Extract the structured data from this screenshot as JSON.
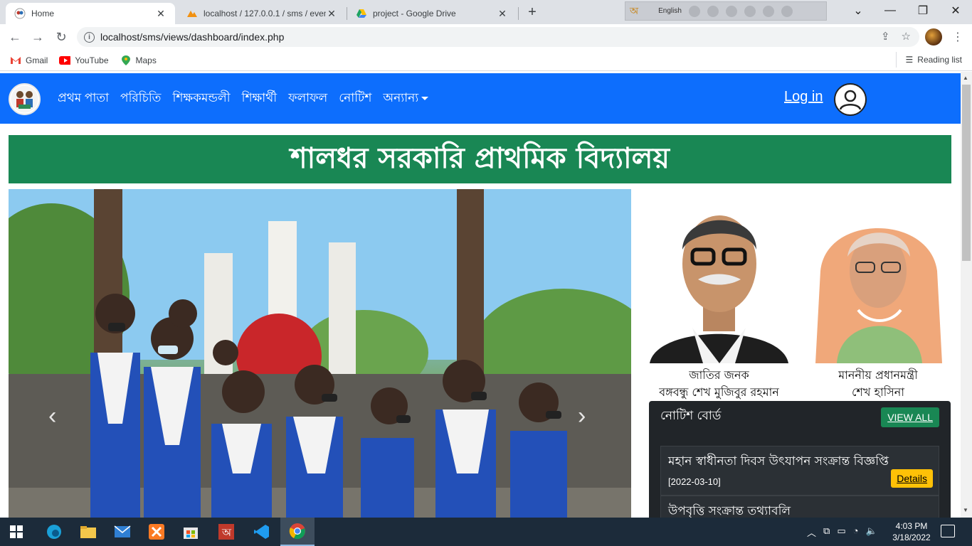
{
  "browser": {
    "tabs": [
      {
        "title": "Home",
        "active": true
      },
      {
        "title": "localhost / 127.0.0.1 / sms / even",
        "active": false
      },
      {
        "title": "project - Google Drive",
        "active": false
      }
    ],
    "language_bar": {
      "label": "English"
    },
    "url": "localhost/sms/views/dashboard/index.php",
    "bookmarks": [
      "Gmail",
      "YouTube",
      "Maps"
    ],
    "reading_list": "Reading list"
  },
  "site": {
    "nav": [
      "প্রথম পাতা",
      "পরিচিতি",
      "শিক্ষকমন্ডলী",
      "শিক্ষার্থী",
      "ফলাফল",
      "নোটিশ",
      "অন্যান্য"
    ],
    "login": "Log in",
    "school_name": "শালধর সরকারি প্রাথমিক বিদ্যালয়",
    "leaders": [
      {
        "line1": "জাতির জনক",
        "line2": "বঙ্গবন্ধু শেখ মুজিবুর রহমান"
      },
      {
        "line1": "মাননীয় প্রধানমন্ত্রী",
        "line2": "শেখ হাসিনা"
      }
    ],
    "notice_board": {
      "title": "নোটিশ বোর্ড",
      "view_all": "VIEW ALL",
      "items": [
        {
          "title": "মহান স্বাধীনতা দিবস উৎযাপন সংক্রান্ত বিজ্ঞপ্তি",
          "date": "[2022-03-10]",
          "action": "Details"
        },
        {
          "title": "উপবৃত্তি সংক্রান্ত তথ্যাবলি"
        }
      ]
    },
    "colors": {
      "nav": "#0d6efd",
      "banner": "#198754",
      "notice_bg": "#212529",
      "details_btn": "#ffc107"
    }
  },
  "taskbar": {
    "time": "4:03 PM",
    "date": "3/18/2022"
  }
}
